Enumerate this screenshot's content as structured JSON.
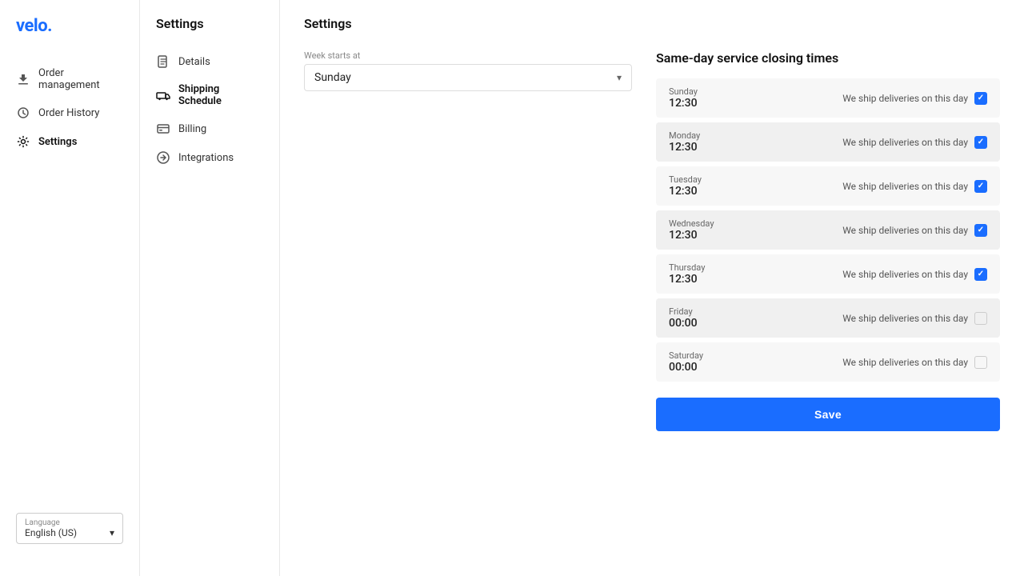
{
  "logo": {
    "text": "velo.",
    "color": "#1a6dff"
  },
  "sidebar": {
    "nav_items": [
      {
        "id": "order-management",
        "label": "Order management",
        "icon": "download"
      },
      {
        "id": "order-history",
        "label": "Order History",
        "icon": "history"
      },
      {
        "id": "settings",
        "label": "Settings",
        "icon": "gear",
        "active": true
      }
    ]
  },
  "settings_nav": {
    "title": "Settings",
    "items": [
      {
        "id": "details",
        "label": "Details",
        "icon": "file"
      },
      {
        "id": "shipping-schedule",
        "label": "Shipping Schedule",
        "icon": "truck",
        "active": true
      },
      {
        "id": "billing",
        "label": "Billing",
        "icon": "card"
      },
      {
        "id": "integrations",
        "label": "Integrations",
        "icon": "circle-arrow"
      }
    ]
  },
  "main": {
    "page_title": "Settings",
    "week_starts": {
      "label": "Week starts at",
      "value": "Sunday"
    },
    "same_day_title": "Same-day service closing times",
    "days": [
      {
        "name": "Sunday",
        "time": "12:30",
        "checked": true
      },
      {
        "name": "Monday",
        "time": "12:30",
        "checked": true
      },
      {
        "name": "Tuesday",
        "time": "12:30",
        "checked": true
      },
      {
        "name": "Wednesday",
        "time": "12:30",
        "checked": true
      },
      {
        "name": "Thursday",
        "time": "12:30",
        "checked": true
      },
      {
        "name": "Friday",
        "time": "00:00",
        "checked": false
      },
      {
        "name": "Saturday",
        "time": "00:00",
        "checked": false
      }
    ],
    "checkbox_label": "We ship deliveries on this day",
    "save_label": "Save"
  },
  "footer": {
    "language_label": "Language",
    "language_value": "English (US)"
  }
}
